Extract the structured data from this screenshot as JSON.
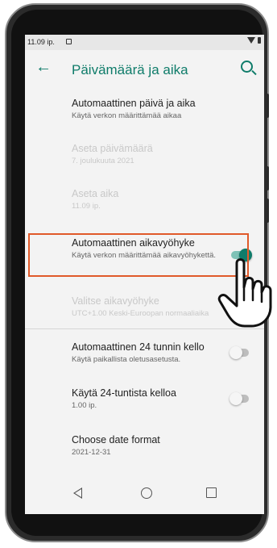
{
  "status_bar": {
    "time": "11.09 ip."
  },
  "app_bar": {
    "title": "Päivämäärä ja aika"
  },
  "settings": [
    {
      "title": "Automaattinen päivä ja aika",
      "subtitle": "Käytä verkon määrittämää aikaa",
      "enabled": true
    },
    {
      "title": "Aseta päivämäärä",
      "subtitle": "7. joulukuuta 2021",
      "enabled": false
    },
    {
      "title": "Aseta aika",
      "subtitle": "11.09 ip.",
      "enabled": false
    },
    {
      "title": "Automaattinen aikavyöhyke",
      "subtitle": "Käytä verkon määrittämää aikavyöhykettä.",
      "enabled": true,
      "toggle": "on"
    },
    {
      "title": "Valitse aikavyöhyke",
      "subtitle": "UTC+1.00 Keski-Euroopan normaaliaika",
      "enabled": false
    },
    {
      "title": "Automaattinen 24 tunnin kello",
      "subtitle": "Käytä paikallista oletusasetusta.",
      "enabled": true,
      "toggle": "off"
    },
    {
      "title": "Käytä 24-tuntista kelloa",
      "subtitle": "1.00 ip.",
      "enabled": true,
      "toggle": "off"
    },
    {
      "title": "Choose date format",
      "subtitle": "2021-12-31",
      "enabled": true
    }
  ],
  "colors": {
    "accent": "#0f7c6a",
    "highlight": "#e05a2a",
    "background": "#f3f3f3"
  },
  "icons": [
    "back-arrow-icon",
    "search-icon",
    "nav-back-icon",
    "nav-home-icon",
    "nav-recents-icon",
    "pointing-hand-icon"
  ]
}
